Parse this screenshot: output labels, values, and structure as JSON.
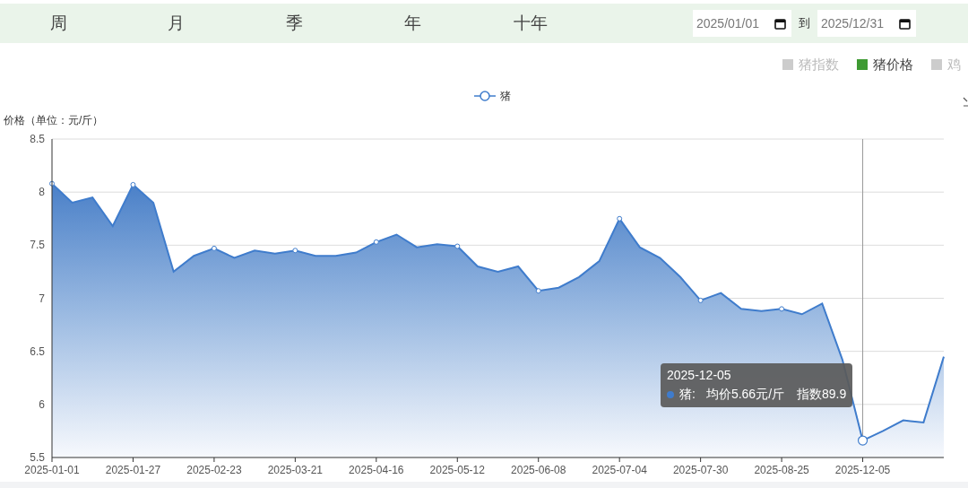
{
  "periods": [
    {
      "label": "周",
      "selected": false
    },
    {
      "label": "月",
      "selected": false
    },
    {
      "label": "季",
      "selected": false
    },
    {
      "label": "年",
      "selected": false
    },
    {
      "label": "十年",
      "selected": false
    }
  ],
  "date_range": {
    "start": "2025/01/01",
    "separator": "到",
    "end": "2025/12/31"
  },
  "series_toggles": [
    {
      "label": "猪指数",
      "on": false
    },
    {
      "label": "猪价格",
      "on": true
    },
    {
      "label": "鸡",
      "on": false
    }
  ],
  "chart": {
    "chart_data": {
      "type": "area",
      "ylabel": "价格（单位：元/斤）",
      "categories": [
        "2025-01-01",
        null,
        null,
        null,
        "2025-01-27",
        null,
        null,
        null,
        "2025-02-23",
        null,
        null,
        null,
        "2025-03-21",
        null,
        null,
        null,
        "2025-04-16",
        null,
        null,
        null,
        "2025-05-12",
        null,
        null,
        null,
        "2025-06-08",
        null,
        null,
        null,
        "2025-07-04",
        null,
        null,
        null,
        "2025-07-30",
        null,
        null,
        null,
        "2025-08-25",
        null,
        null,
        null,
        "2025-12-05",
        null,
        null,
        null,
        null
      ],
      "series": [
        {
          "name": "猪",
          "color": "#3f7ccc",
          "values": [
            8.08,
            7.9,
            7.95,
            7.68,
            8.07,
            7.9,
            7.25,
            7.4,
            7.47,
            7.38,
            7.45,
            7.42,
            7.45,
            7.4,
            7.4,
            7.43,
            7.53,
            7.6,
            7.48,
            7.51,
            7.49,
            7.3,
            7.25,
            7.3,
            7.07,
            7.1,
            7.2,
            7.35,
            7.75,
            7.48,
            7.38,
            7.2,
            6.98,
            7.05,
            6.9,
            6.88,
            6.9,
            6.85,
            6.95,
            6.42,
            5.66,
            5.75,
            5.85,
            5.83,
            6.45
          ]
        }
      ],
      "ylim": [
        5.5,
        8.5
      ],
      "grid": true,
      "yticks": [
        5.5,
        6,
        6.5,
        7,
        7.5,
        8,
        8.5
      ]
    },
    "tooltip": {
      "title": "2025-12-05",
      "series": "猪:",
      "price": "均价5.66元/斤",
      "index": "指数89.9"
    }
  }
}
